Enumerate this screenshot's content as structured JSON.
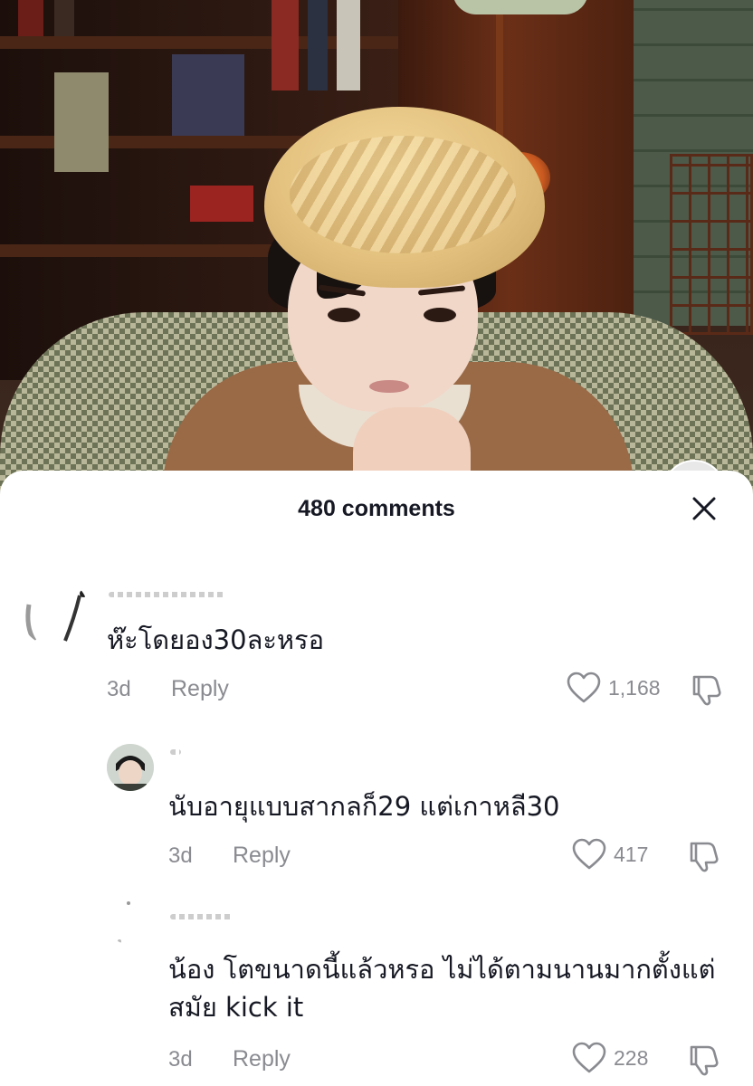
{
  "sheet": {
    "title": "480 comments",
    "close_icon": "close-icon"
  },
  "comments": [
    {
      "text": "ห๊ะโดยอง30ละหรอ",
      "age": "3d",
      "reply_label": "Reply",
      "likes": "1,168"
    },
    {
      "text": "นับอายุแบบสากลก็29 แต่เกาหลี30",
      "age": "3d",
      "reply_label": "Reply",
      "likes": "417"
    },
    {
      "text": "น้อง โตขนาดนี้แล้วหรอ ไม่ได้ตามนานมากตั้งแต่สมัย kick it",
      "age": "3d",
      "reply_label": "Reply",
      "likes": "228"
    }
  ],
  "icons": {
    "like": "heart-outline-icon",
    "dislike": "thumbs-down-icon"
  },
  "colors": {
    "text": "#161823",
    "secondary": "#8a8b91",
    "sheet_bg": "#ffffff"
  }
}
